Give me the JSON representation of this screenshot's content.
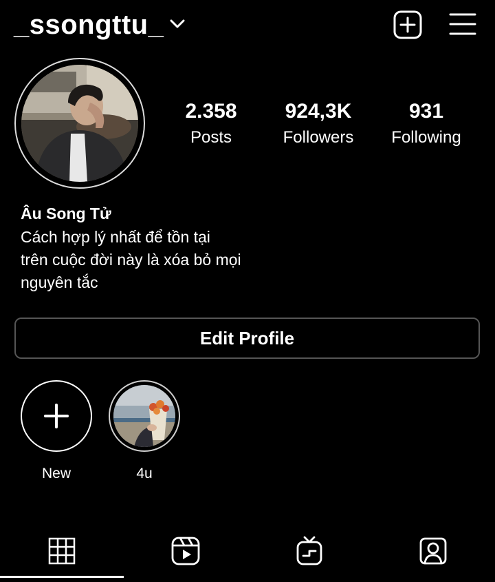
{
  "header": {
    "username": "_ssongttu_",
    "dropdown_icon": "chevron-down-icon",
    "new_post_icon": "plus-square-icon",
    "menu_icon": "hamburger-menu-icon"
  },
  "profile": {
    "avatar_icon": "profile-photo",
    "stats": [
      {
        "value": "2.358",
        "label": "Posts"
      },
      {
        "value": "924,3K",
        "label": "Followers"
      },
      {
        "value": "931",
        "label": "Following"
      }
    ],
    "full_name": "Âu Song Tử",
    "bio_lines": [
      "Cách hợp lý nhất để tồn tại",
      "trên cuộc đời này là xóa bỏ mọi",
      "nguyên tắc"
    ]
  },
  "edit_profile_label": "Edit Profile",
  "highlights": [
    {
      "label": "New",
      "icon": "plus-icon"
    },
    {
      "label": "4u",
      "icon": "highlight-cover-flowers"
    }
  ],
  "tabs": [
    {
      "name": "posts-grid",
      "icon": "grid-icon",
      "active": true
    },
    {
      "name": "reels",
      "icon": "reels-icon",
      "active": false
    },
    {
      "name": "igtv",
      "icon": "igtv-icon",
      "active": false
    },
    {
      "name": "tagged",
      "icon": "tagged-person-icon",
      "active": false
    }
  ],
  "colors": {
    "background": "#000000",
    "text": "#ffffff",
    "button_border": "#555555"
  }
}
